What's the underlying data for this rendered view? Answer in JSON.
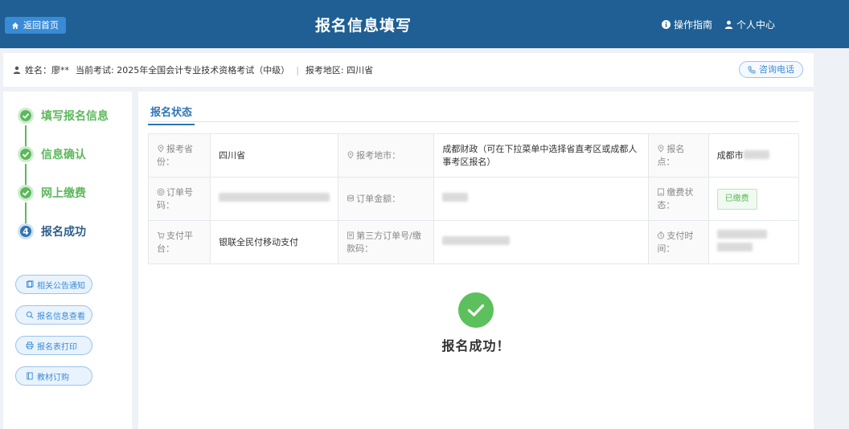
{
  "header": {
    "back_label": "返回首页",
    "title": "报名信息填写",
    "guide_label": "操作指南",
    "personal_label": "个人中心",
    "bg_color": "#1f5f94"
  },
  "infobar": {
    "name": "姓名：廖**",
    "exam": "当前考试: 2025年全国会计专业技术资格考试（中级）",
    "region": "报考地区: 四川省",
    "consult_label": "咨询电话"
  },
  "steps": [
    {
      "label": "填写报名信息",
      "state": "done"
    },
    {
      "label": "信息确认",
      "state": "done"
    },
    {
      "label": "网上缴费",
      "state": "done"
    },
    {
      "label": "报名成功",
      "state": "current",
      "number": "4"
    }
  ],
  "side_buttons": [
    {
      "label": "相关公告通知",
      "icon": "notice-icon"
    },
    {
      "label": "报名信息查看",
      "icon": "search-icon"
    },
    {
      "label": "报名表打印",
      "icon": "print-icon"
    },
    {
      "label": "教材订购",
      "icon": "book-icon"
    }
  ],
  "section_title": "报名状态",
  "table": {
    "province_key": "报考省份：",
    "province_val": "四川省",
    "city_key": "报考地市：",
    "city_val": "成都财政（可在下拉菜单中选择省直考区或成都人事考区报名）",
    "site_key": "报名点：",
    "site_val": "成都市",
    "order_key": "订单号码：",
    "amount_key": "订单金额：",
    "pay_status_key": "缴费状态：",
    "pay_status_val": "已缴费",
    "platform_key": "支付平台：",
    "platform_val": "银联全民付移动支付",
    "third_key": "第三方订单号/缴款码：",
    "time_key": "支付时间："
  },
  "success_message": "报名成功！",
  "colors": {
    "success": "#5cb85c",
    "primary": "#2f74b5"
  }
}
